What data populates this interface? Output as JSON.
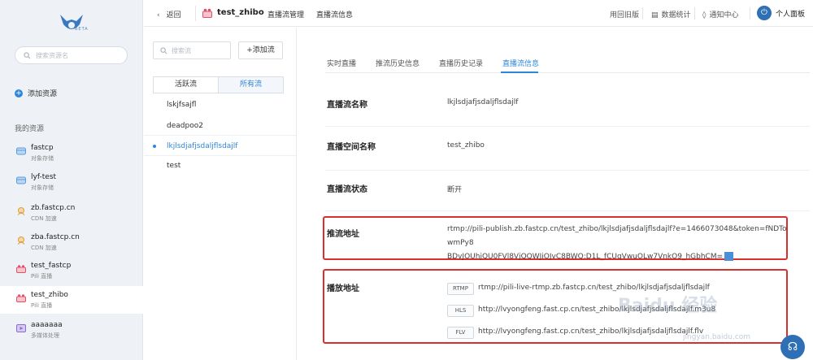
{
  "sidebar": {
    "logo_text": "BETA",
    "search_placeholder": "搜索资源名",
    "add_resource": "添加资源",
    "my_resources": "我的资源",
    "items": [
      {
        "name": "fastcp",
        "sub": "对象存储",
        "icon": "storage-icon"
      },
      {
        "name": "lyf-test",
        "sub": "对象存储",
        "icon": "storage-icon"
      },
      {
        "name": "zb.fastcp.cn",
        "sub": "CDN 加速",
        "icon": "cdn-icon"
      },
      {
        "name": "zba.fastcp.cn",
        "sub": "CDN 加速",
        "icon": "cdn-icon"
      },
      {
        "name": "test_fastcp",
        "sub": "Pili 直播",
        "icon": "live-icon"
      },
      {
        "name": "test_zhibo",
        "sub": "Pili 直播",
        "icon": "live-icon"
      },
      {
        "name": "aaaaaaa",
        "sub": "多媒体处理",
        "icon": "media-icon"
      }
    ]
  },
  "topbar": {
    "back": "返回",
    "app_name": "test_zhibo",
    "nav_stream_manage": "直播流管理",
    "nav_stream_info": "直播流信息",
    "old_version": "用回旧版",
    "stats": "数据统计",
    "notifications": "通知中心",
    "personal_panel": "个人面板"
  },
  "streams": {
    "search_placeholder": "搜索流",
    "add_stream": "+添加流",
    "tab_active": "活跃流",
    "tab_all": "所有流",
    "items": [
      "lskjfsajfl",
      "deadpoo2",
      "lkjlsdjafjsdaljflsdajlf",
      "test"
    ]
  },
  "main": {
    "tabs": [
      "实时直播",
      "推流历史信息",
      "直播历史记录",
      "直播流信息"
    ],
    "stream_name_label": "直播流名称",
    "stream_name_value": "lkjlsdjafjsdaljflsdajlf",
    "space_name_label": "直播空间名称",
    "space_name_value": "test_zhibo",
    "status_label": "直播流状态",
    "status_value": "断开",
    "publish_label": "推流地址",
    "publish_url_line1": "rtmp://pili-publish.zb.fastcp.cn/test_zhibo/lkjlsdjafjsdaljflsdajlf?e=1466073048&token=fNDTowmPy8",
    "publish_url_line2": "BDvJOUhjQU0FVl8VjQQWJiOJvC8BWQ:D1L_fCUqVwuOLw7VnkO9_hGbhCM=",
    "play_label": "播放地址",
    "play_rtmp_tag": "RTMP",
    "play_rtmp_url": "rtmp://pili-live-rtmp.zb.fastcp.cn/test_zhibo/lkjlsdjafjsdaljflsdajlf",
    "play_hls_tag": "HLS",
    "play_hls_url": "http://lvyongfeng.fast.cp.cn/test_zhibo/lkjlsdjafjsdaljflsdajlf.m3u8",
    "play_flv_tag": "FLV",
    "play_flv_url": "http://lvyongfeng.fast.cp.cn/test_zhibo/lkjlsdjafjsdaljflsdajlf.flv"
  },
  "watermark": {
    "brand": "Baidu 经验",
    "site": "jingyan.baidu.com"
  },
  "colors": {
    "accent": "#2f86d9",
    "highlight_box": "#d9302c",
    "sidebar_bg": "#eef1f5"
  }
}
